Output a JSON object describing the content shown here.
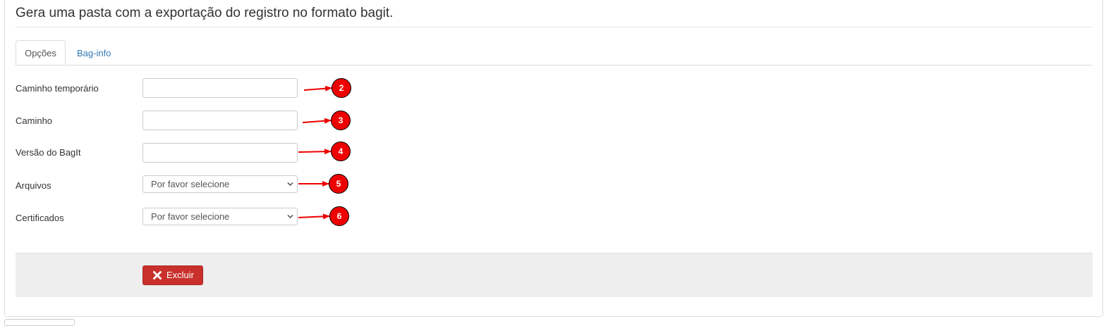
{
  "header": {
    "title": "Gera uma pasta com a exportação do registro no formato bagit."
  },
  "tabs": [
    {
      "label": "Opções",
      "active": true
    },
    {
      "label": "Bag-info",
      "active": false
    }
  ],
  "form": {
    "fields": [
      {
        "label": "Caminho temporário",
        "type": "text",
        "value": ""
      },
      {
        "label": "Caminho",
        "type": "text",
        "value": ""
      },
      {
        "label": "Versão do BagIt",
        "type": "text",
        "value": ""
      },
      {
        "label": "Arquivos",
        "type": "select",
        "selected": "Por favor selecione"
      },
      {
        "label": "Certificados",
        "type": "select",
        "selected": "Por favor selecione"
      }
    ]
  },
  "annotations": {
    "badges": [
      "2",
      "3",
      "4",
      "5",
      "6"
    ],
    "color": "#ee0000"
  },
  "actions": {
    "delete_label": "Excluir",
    "delete_icon": "close-icon",
    "delete_color": "#c9302c"
  },
  "colors": {
    "link": "#337ab7",
    "footer_bg": "#eeeeee"
  }
}
